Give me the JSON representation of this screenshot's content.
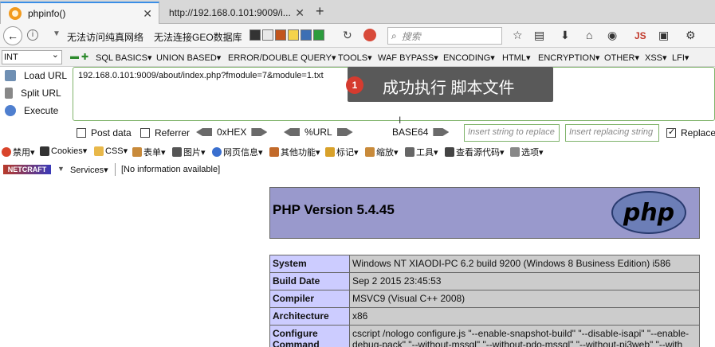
{
  "tabs": [
    {
      "title": "phpinfo()",
      "close": "✕"
    },
    {
      "title": "http://192.168.0.101:9009/i...",
      "close": "✕"
    }
  ],
  "new_tab": "+",
  "nav": {
    "bookmark1": "无法访问纯真网络",
    "bookmark2": "无法连接GEO数据库",
    "search_placeholder": "搜索",
    "js_label": "JS"
  },
  "hackbar": {
    "select_value": "INT",
    "menus": [
      "SQL BASICS▾",
      "UNION BASED▾",
      "ERROR/DOUBLE QUERY▾",
      "TOOLS▾",
      "WAF BYPASS▾",
      "ENCODING▾",
      "HTML▾",
      "ENCRYPTION▾",
      "OTHER▾",
      "XSS▾",
      "LFI▾"
    ],
    "actions": [
      "Load URL",
      "Split URL",
      "Execute"
    ],
    "url": "192.168.0.101:9009/about/index.php?fmodule=7&module=1.txt",
    "options": {
      "post_data": "Post data",
      "referrer": "Referrer",
      "hex": "0xHEX",
      "url_enc": "%URL",
      "base64": "BASE64",
      "insert_string_placeholder": "Insert string to replace",
      "insert_replacing_placeholder": "Insert replacing string",
      "replace_all": "Replace All"
    }
  },
  "tooltip": {
    "badge": "1",
    "text": "成功执行 脚本文件"
  },
  "webdev": [
    "禁用▾",
    "Cookies▾",
    "CSS▾",
    "表单▾",
    "图片▾",
    "网页信息▾",
    "其他功能▾",
    "标记▾",
    "缩放▾",
    "工具▾",
    "查看源代码▾",
    "选项▾"
  ],
  "netcraft": {
    "logo": "NETCRAFT",
    "services": "Services▾",
    "info": "[No information available]"
  },
  "php": {
    "title": "PHP Version 5.4.45",
    "logo": "php",
    "rows": [
      {
        "key": "System",
        "value": "Windows NT XIAODI-PC 6.2 build 9200 (Windows 8 Business Edition) i586"
      },
      {
        "key": "Build Date",
        "value": "Sep 2 2015 23:45:53"
      },
      {
        "key": "Compiler",
        "value": "MSVC9 (Visual C++ 2008)"
      },
      {
        "key": "Architecture",
        "value": "x86"
      },
      {
        "key": "Configure Command",
        "value": "cscript /nologo configure.js \"--enable-snapshot-build\" \"--disable-isapi\" \"--enable-debug-pack\" \"--without-mssql\" \"--without-pdo-mssql\" \"--without-pi3web\" \"--with"
      }
    ]
  }
}
